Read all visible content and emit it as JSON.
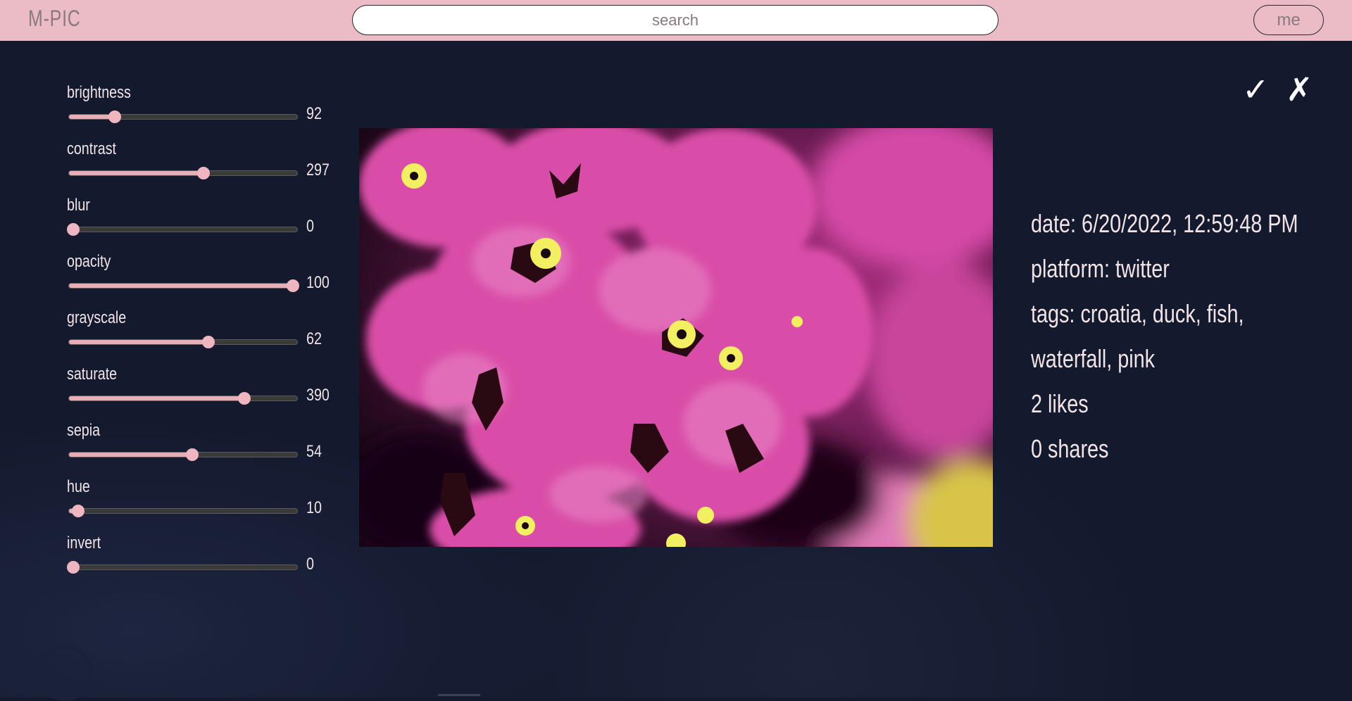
{
  "app": {
    "logo": "M-PIC"
  },
  "search": {
    "placeholder": "search"
  },
  "header": {
    "me_label": "me"
  },
  "actions": {
    "confirm_icon": "✓",
    "cancel_icon": "✗"
  },
  "controls": [
    {
      "label": "brightness",
      "value": "92",
      "fraction": 0.2
    },
    {
      "label": "contrast",
      "value": "297",
      "fraction": 0.59
    },
    {
      "label": "blur",
      "value": "0",
      "fraction": 0.02
    },
    {
      "label": "opacity",
      "value": "100",
      "fraction": 0.98
    },
    {
      "label": "grayscale",
      "value": "62",
      "fraction": 0.61
    },
    {
      "label": "saturate",
      "value": "390",
      "fraction": 0.77
    },
    {
      "label": "sepia",
      "value": "54",
      "fraction": 0.54
    },
    {
      "label": "hue",
      "value": "10",
      "fraction": 0.04
    },
    {
      "label": "invert",
      "value": "0",
      "fraction": 0.02
    }
  ],
  "info": {
    "date": "date: 6/20/2022, 12:59:48 PM",
    "platform": "platform: twitter",
    "tags": "tags: croatia, duck, fish, waterfall, pink",
    "likes": "2 likes",
    "shares": "0 shares"
  },
  "colors": {
    "topbar": "#ebbcc6",
    "background": "#141a2e",
    "slider_fill": "#e8aeb8",
    "slider_track": "#3a3a3a",
    "flower_pink": "#d94ea8",
    "flower_center": "#f2f060"
  }
}
